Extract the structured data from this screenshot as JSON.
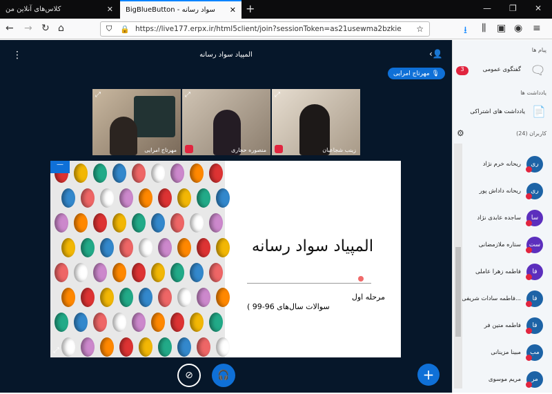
{
  "browser": {
    "tab1": "کلاس‌های آنلاین من",
    "tab2": "BigBlueButton - سواد رسانه",
    "url": "https://live177.erpx.ir/html5client/join?sessionToken=as21usewma2bzkie"
  },
  "meeting": {
    "title": "المپیاد سواد رسانه",
    "speaking": "مهرتاج امرایی"
  },
  "videos": [
    {
      "name": "مهرتاج امرایی"
    },
    {
      "name": "منصوره حجاری"
    },
    {
      "name": "زینب شجاعیان"
    }
  ],
  "slide": {
    "title": "المپیاد سواد رسانه",
    "sub1": "مرحله اول",
    "sub2": "( سوالات سال‌های 96-99"
  },
  "sidebar": {
    "messages": "پیام ها",
    "public_chat": "گفتگوی عمومی",
    "unread": "3",
    "notes": "یادداشت ها",
    "shared_notes": "یادداشت های اشتراکی",
    "users": "کاربران (24)",
    "list": [
      {
        "name": "ریحانه خرم نژاد",
        "init": "ری",
        "color": "#1d63a6"
      },
      {
        "name": "ریحانه داداش پور",
        "init": "ری",
        "color": "#1d63a6"
      },
      {
        "name": "ساجده عابدی نژاد",
        "init": "سا",
        "color": "#5c2fbd"
      },
      {
        "name": "ستاره ملازمضانی",
        "init": "ست",
        "color": "#5c2fbd"
      },
      {
        "name": "فاطمه زهرا عاملی",
        "init": "فا",
        "color": "#5c2fbd"
      },
      {
        "name": "فاطمه سادات شریفی ا...",
        "init": "فا",
        "color": "#1d63a6"
      },
      {
        "name": "فاطمه متین فر",
        "init": "فا",
        "color": "#1d63a6"
      },
      {
        "name": "مبینا مزینانی",
        "init": "مب",
        "color": "#1d63a6"
      },
      {
        "name": "مریم موسوی",
        "init": "مر",
        "color": "#1d63a6"
      }
    ]
  }
}
